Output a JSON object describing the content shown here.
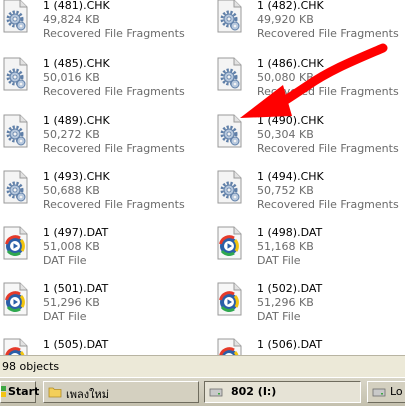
{
  "files": [
    {
      "name": "1 (481).CHK",
      "size": "49,824 KB",
      "type": "Recovered File Fragments",
      "icon": "chk-file-icon"
    },
    {
      "name": "1 (482).CHK",
      "size": "49,920 KB",
      "type": "Recovered File Fragments",
      "icon": "chk-file-icon"
    },
    {
      "name": "1 (485).CHK",
      "size": "50,016 KB",
      "type": "Recovered File Fragments",
      "icon": "chk-file-icon"
    },
    {
      "name": "1 (486).CHK",
      "size": "50,080 KB",
      "type": "Recovered File Fragments",
      "icon": "chk-file-icon"
    },
    {
      "name": "1 (489).CHK",
      "size": "50,272 KB",
      "type": "Recovered File Fragments",
      "icon": "chk-file-icon"
    },
    {
      "name": "1 (490).CHK",
      "size": "50,304 KB",
      "type": "Recovered File Fragments",
      "icon": "chk-file-icon"
    },
    {
      "name": "1 (493).CHK",
      "size": "50,688 KB",
      "type": "Recovered File Fragments",
      "icon": "chk-file-icon"
    },
    {
      "name": "1 (494).CHK",
      "size": "50,752 KB",
      "type": "Recovered File Fragments",
      "icon": "chk-file-icon"
    },
    {
      "name": "1 (497).DAT",
      "size": "51,008 KB",
      "type": "DAT File",
      "icon": "dat-file-icon"
    },
    {
      "name": "1 (498).DAT",
      "size": "51,168 KB",
      "type": "DAT File",
      "icon": "dat-file-icon"
    },
    {
      "name": "1 (501).DAT",
      "size": "51,296 KB",
      "type": "DAT File",
      "icon": "dat-file-icon"
    },
    {
      "name": "1 (502).DAT",
      "size": "51,296 KB",
      "type": "DAT File",
      "icon": "dat-file-icon"
    },
    {
      "name": "1 (505).DAT",
      "size": "",
      "type": "",
      "icon": "dat-file-icon"
    },
    {
      "name": "1 (506).DAT",
      "size": "",
      "type": "",
      "icon": "dat-file-icon"
    }
  ],
  "status_bar": {
    "text": "98 objects"
  },
  "taskbar": {
    "start_label": "Start",
    "buttons": [
      {
        "label": "เพลงใหม่",
        "icon": "folder-icon"
      },
      {
        "label": "802 (I:)",
        "icon": "drive-icon"
      },
      {
        "label": "Lo",
        "icon": "drive-icon"
      }
    ]
  },
  "annotation": {
    "icon": "red-arrow-icon",
    "color": "#ff0000"
  },
  "colors": {
    "secondary_text": "#6b6b6b",
    "taskbar": "#d4d0c0",
    "status_bar": "#ece9d8"
  }
}
